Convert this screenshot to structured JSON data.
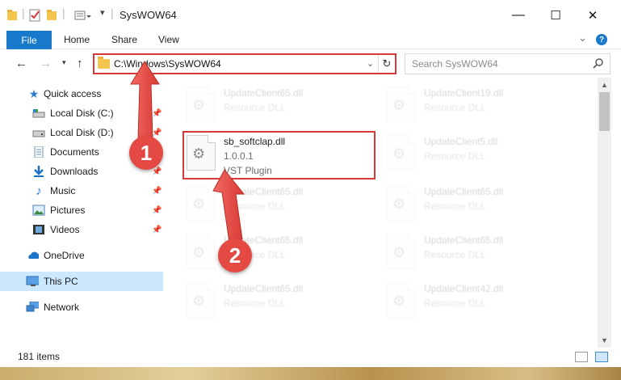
{
  "window": {
    "title": "SysWOW64",
    "controls": {
      "minimize": "—",
      "maximize": "☐",
      "close": "✕"
    }
  },
  "ribbon": {
    "file_tab": "File",
    "tabs": [
      "Home",
      "Share",
      "View"
    ],
    "help_label": "?"
  },
  "navigation": {
    "address": "C:\\Windows\\SysWOW64",
    "search_placeholder": "Search SysWOW64"
  },
  "sidebar": {
    "items": [
      {
        "label": "Quick access",
        "icon": "star-icon"
      },
      {
        "label": "Local Disk (C:)",
        "icon": "drive-icon",
        "pinned": true
      },
      {
        "label": "Local Disk (D:)",
        "icon": "drive-icon",
        "pinned": true
      },
      {
        "label": "Documents",
        "icon": "documents-icon",
        "pinned": true
      },
      {
        "label": "Downloads",
        "icon": "downloads-icon",
        "pinned": true
      },
      {
        "label": "Music",
        "icon": "music-icon",
        "pinned": true
      },
      {
        "label": "Pictures",
        "icon": "pictures-icon",
        "pinned": true
      },
      {
        "label": "Videos",
        "icon": "videos-icon",
        "pinned": true
      },
      {
        "label": "OneDrive",
        "icon": "cloud-icon"
      },
      {
        "label": "This PC",
        "icon": "pc-icon",
        "selected": true
      },
      {
        "label": "Network",
        "icon": "network-icon"
      }
    ]
  },
  "files": {
    "highlighted": {
      "name": "sb_softclap.dll",
      "version": "1.0.0.1",
      "type": "VST Plugin"
    },
    "background": [
      {
        "name": "UpdateClient65.dll",
        "type": "Resource DLL"
      },
      {
        "name": "UpdateClient19.dll",
        "type": "Resource DLL"
      },
      {
        "name": "UpdateClient5.dll",
        "type": "Resource DLL"
      },
      {
        "name": "UpdateClient65.dll",
        "type": "Resource DLL"
      },
      {
        "name": "UpdateClient65.dll",
        "type": "Resource DLL"
      },
      {
        "name": "UpdateClient65.dll",
        "type": "Resource DLL"
      },
      {
        "name": "UpdateClient65.dll",
        "type": "Resource DLL"
      },
      {
        "name": "UpdateClient65.dll",
        "type": "Resource DLL"
      },
      {
        "name": "UpdateClient42.dll",
        "type": "Resource DLL"
      }
    ]
  },
  "status": {
    "item_count": "181 items"
  },
  "annotations": {
    "badge_1": "1",
    "badge_2": "2",
    "accent_color": "#e44a43"
  },
  "colors": {
    "file_tab": "#1979ca",
    "selected_nav": "#cce8ff",
    "highlight_border": "#d9383a"
  }
}
